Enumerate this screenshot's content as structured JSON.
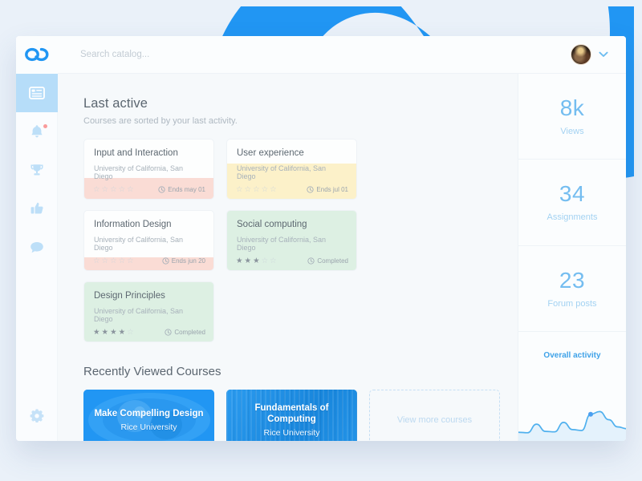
{
  "theme": {
    "page_bg": "#eaf1f9",
    "accent_blue": "#2196f3",
    "panel_bg": "#f6f9fb",
    "tint_pink": "#fadcd5",
    "tint_yellow": "#fcf1c9",
    "tint_green": "#ddf0e3"
  },
  "topbar": {
    "logo_icon": "infinity-loop-logo",
    "search": {
      "placeholder": "Search catalog...",
      "value": ""
    },
    "avatar_icon": "user-avatar",
    "chevron_icon": "chevron-down-icon"
  },
  "sidebar": {
    "items": [
      {
        "icon": "dashboard-icon",
        "label": "Dashboard",
        "active": true,
        "badge": false
      },
      {
        "icon": "bell-icon",
        "label": "Notifications",
        "active": false,
        "badge": true
      },
      {
        "icon": "trophy-icon",
        "label": "Achievements",
        "active": false,
        "badge": false
      },
      {
        "icon": "thumbs-up-icon",
        "label": "Likes",
        "active": false,
        "badge": false
      },
      {
        "icon": "chat-bubble-icon",
        "label": "Messages",
        "active": false,
        "badge": false
      }
    ],
    "settings": {
      "icon": "gear-icon",
      "label": "Settings"
    }
  },
  "main": {
    "section_title": "Last active",
    "section_subtitle": "Courses are sorted by your last activity.",
    "courses": [
      {
        "title": "Input and Interaction",
        "school": "University of California, San Diego",
        "stars_filled": 0,
        "stars_total": 5,
        "status_icon": "clock-icon",
        "status": "Ends may 01",
        "tint": "pink",
        "tint_mode": "footer"
      },
      {
        "title": "User experience",
        "school": "University of California, San Diego",
        "stars_filled": 0,
        "stars_total": 5,
        "status_icon": "clock-icon",
        "status": "Ends jul 01",
        "tint": "yellow",
        "tint_mode": "body"
      },
      {
        "title": "Information Design",
        "school": "University of California, San Diego",
        "stars_filled": 0,
        "stars_total": 5,
        "status_icon": "clock-icon",
        "status": "Ends jun 20",
        "tint": "pink",
        "tint_mode": "strip"
      },
      {
        "title": "Social computing",
        "school": "University of California, San Diego",
        "stars_filled": 3,
        "stars_total": 5,
        "status_icon": "clock-icon",
        "status": "Completed",
        "tint": "green",
        "tint_mode": "full"
      },
      {
        "title": "Design Principles",
        "school": "University of California, San Diego",
        "stars_filled": 4,
        "stars_total": 5,
        "status_icon": "clock-icon",
        "status": "Completed",
        "tint": "green",
        "tint_mode": "full"
      }
    ],
    "recent_title": "Recently Viewed Courses",
    "recent_courses": [
      {
        "title": "Make Compelling Design",
        "school": "Rice University"
      },
      {
        "title": "Fundamentals of Computing",
        "school": "Rice University"
      }
    ],
    "view_more_label": "View more courses"
  },
  "right_panel": {
    "stats": [
      {
        "value": "8k",
        "label": "Views"
      },
      {
        "value": "34",
        "label": "Assignments"
      },
      {
        "value": "23",
        "label": "Forum posts"
      }
    ],
    "activity_label": "Overall activity"
  },
  "chart_data": {
    "type": "area",
    "title": "Overall activity",
    "x": [
      0,
      1,
      2,
      3,
      4,
      5,
      6,
      7,
      8,
      9,
      10,
      11,
      12
    ],
    "values": [
      12,
      11,
      30,
      14,
      13,
      34,
      18,
      16,
      52,
      58,
      40,
      24,
      20
    ],
    "marker_index": 8,
    "marker_value": 52,
    "xlabel": "",
    "ylabel": "",
    "ylim": [
      0,
      64
    ],
    "grid": false,
    "legend": "none",
    "line_color": "#4fb0ee",
    "fill_color": "#dceefb"
  }
}
